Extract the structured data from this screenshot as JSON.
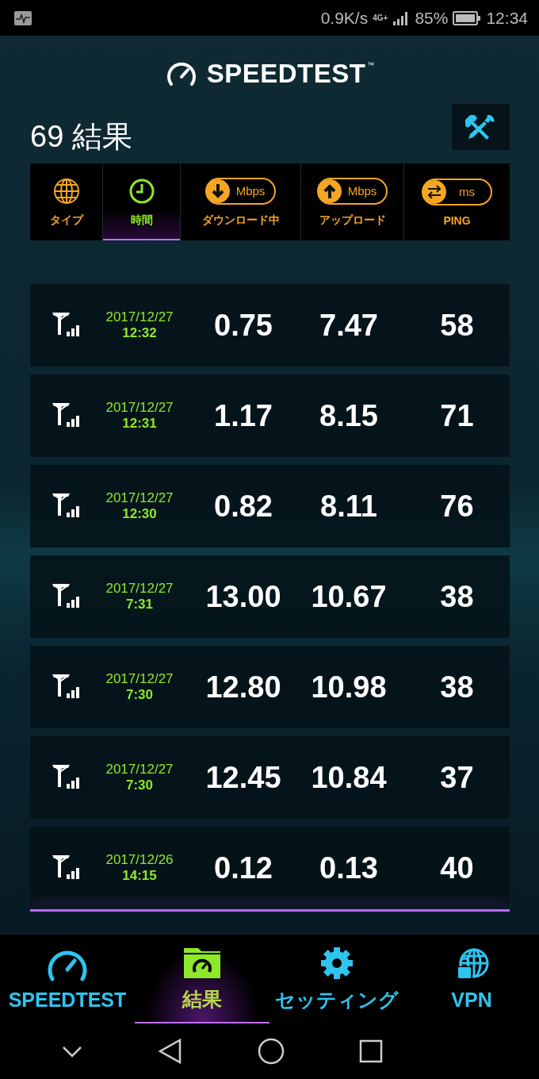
{
  "status_bar": {
    "speed": "0.9K/s",
    "network": "4G+",
    "battery": "85%",
    "time": "12:34"
  },
  "logo": {
    "text": "SPEEDTEST",
    "mark": "™"
  },
  "title": "69 結果",
  "columns": [
    {
      "kind": "type",
      "label": "タイプ",
      "selected": false
    },
    {
      "kind": "time",
      "label": "時間",
      "selected": true
    },
    {
      "kind": "download",
      "label": "ダウンロード中",
      "unit": "Mbps",
      "selected": false
    },
    {
      "kind": "upload",
      "label": "アップロード",
      "unit": "Mbps",
      "selected": false
    },
    {
      "kind": "ping",
      "label": "PING",
      "unit": "ms",
      "selected": false
    }
  ],
  "results": [
    {
      "date": "2017/12/27",
      "time": "12:32",
      "download": "0.75",
      "upload": "7.47",
      "ping": "58"
    },
    {
      "date": "2017/12/27",
      "time": "12:31",
      "download": "1.17",
      "upload": "8.15",
      "ping": "71"
    },
    {
      "date": "2017/12/27",
      "time": "12:30",
      "download": "0.82",
      "upload": "8.11",
      "ping": "76"
    },
    {
      "date": "2017/12/27",
      "time": "7:31",
      "download": "13.00",
      "upload": "10.67",
      "ping": "38"
    },
    {
      "date": "2017/12/27",
      "time": "7:30",
      "download": "12.80",
      "upload": "10.98",
      "ping": "38"
    },
    {
      "date": "2017/12/27",
      "time": "7:30",
      "download": "12.45",
      "upload": "10.84",
      "ping": "37"
    },
    {
      "date": "2017/12/26",
      "time": "14:15",
      "download": "0.12",
      "upload": "0.13",
      "ping": "40"
    }
  ],
  "bottom_nav": [
    {
      "kind": "speedtest",
      "label": "SPEEDTEST",
      "selected": false
    },
    {
      "kind": "results",
      "label": "結果",
      "selected": true
    },
    {
      "kind": "settings",
      "label": "セッティング",
      "selected": false
    },
    {
      "kind": "vpn",
      "label": "VPN",
      "selected": false
    }
  ]
}
